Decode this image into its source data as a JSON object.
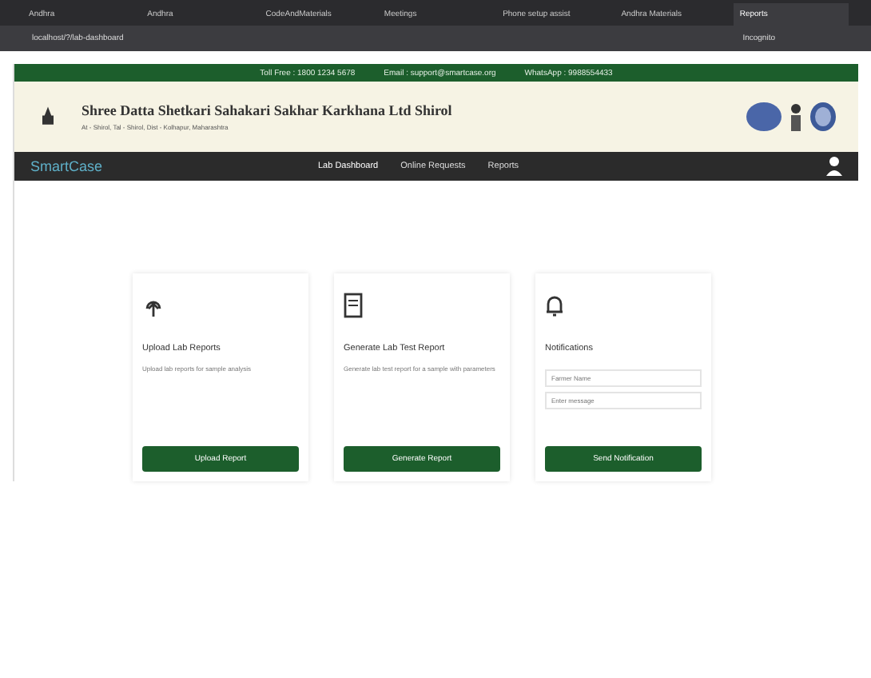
{
  "browser": {
    "tabs": [
      {
        "label": "Andhra",
        "selected": false
      },
      {
        "label": "Andhra",
        "selected": false
      },
      {
        "label": "CodeAndMaterials",
        "selected": false
      },
      {
        "label": "Meetings",
        "selected": false
      },
      {
        "label": "Phone setup assist",
        "selected": false
      },
      {
        "label": "Andhra Materials",
        "selected": false
      },
      {
        "label": "Reports",
        "selected": true
      }
    ],
    "address": "localhost/?/lab-dashboard",
    "profile": "Incognito"
  },
  "topbar": {
    "items": [
      "Toll Free : 1800 1234 5678",
      "Email : support@smartcase.org",
      "WhatsApp : 9988554433"
    ]
  },
  "header": {
    "title": "Shree Datta Shetkari Sahakari Sakhar Karkhana Ltd Shirol",
    "subtitle": "At - Shirol, Tal - Shirol, Dist - Kolhapur, Maharashtra"
  },
  "nav": {
    "brand": "SmartCase",
    "links": [
      {
        "label": "Lab Dashboard",
        "selected": true
      },
      {
        "label": "Online Requests",
        "selected": false
      },
      {
        "label": "Reports",
        "selected": false
      }
    ]
  },
  "cards": [
    {
      "kind": "upload",
      "title": "Upload Lab Reports",
      "text": "Upload lab reports for sample analysis",
      "button": "Upload Report"
    },
    {
      "kind": "report",
      "title": "Generate Lab Test Report",
      "text": "Generate lab test report for a sample with parameters",
      "button": "Generate Report"
    },
    {
      "kind": "notify",
      "title": "Notifications",
      "fields": [
        {
          "placeholder": "Farmer Name"
        },
        {
          "placeholder": "Enter message"
        }
      ],
      "button": "Send Notification"
    }
  ]
}
